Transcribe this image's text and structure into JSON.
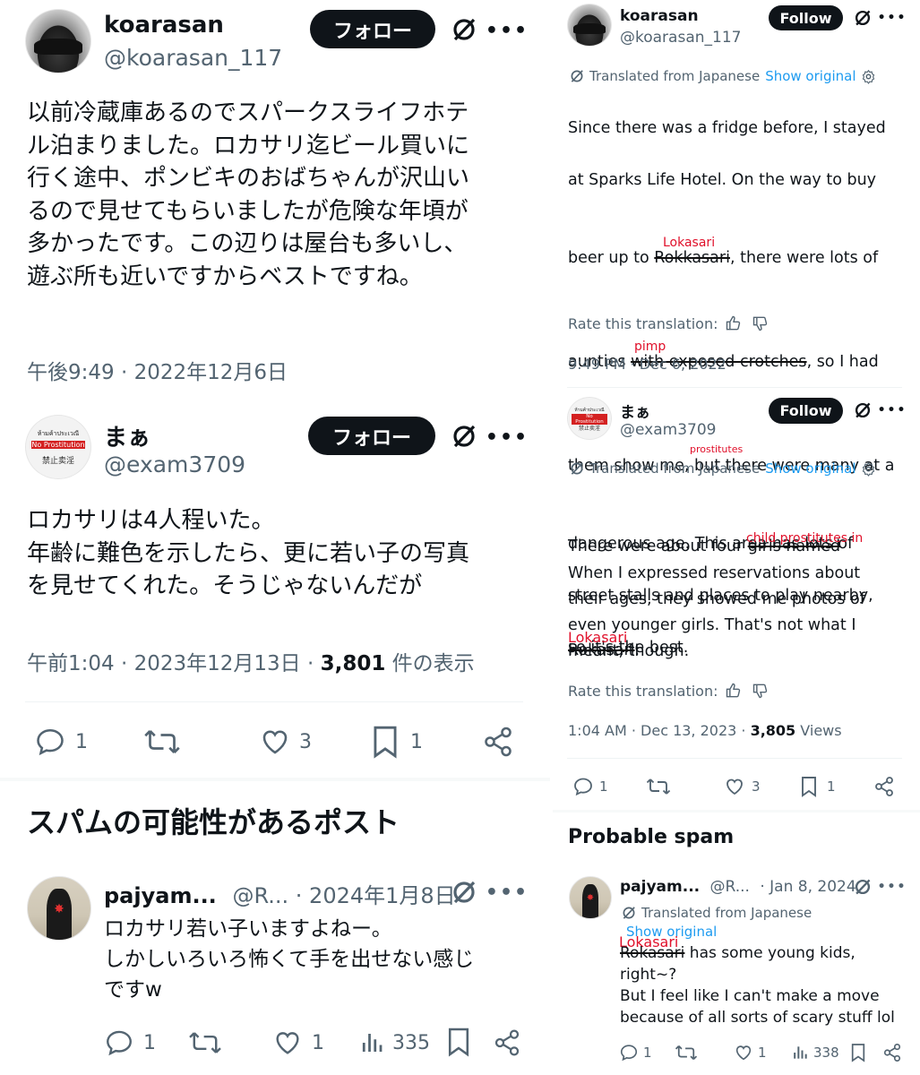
{
  "left": {
    "post1": {
      "name": "koarasan",
      "handle": "@koarasan_117",
      "follow_label": "フォロー",
      "text": "以前冷蔵庫あるのでスパークスライフホテ\nル泊まりました。ロカサリ迄ビール買いに\n行く途中、ポンビキのおばちゃんが沢山い\nるので見せてもらいましたが危険な年頃が\n多かったです。この辺りは屋台も多いし、\n遊ぶ所も近いですからベストですね。",
      "timestamp": "午後9:49 · 2022年12月6日"
    },
    "post2": {
      "name": "まぁ",
      "handle": "@exam3709",
      "follow_label": "フォロー",
      "text": "ロカサリは4人程いた。\n年齢に難色を示したら、更に若い子の写真\nを見せてくれた。そうじゃないんだが",
      "timestamp": "午前1:04 · 2023年12月13日 · ",
      "views_count": "3,801",
      "views_label": " 件の表示",
      "replies": "1",
      "reposts": "",
      "likes": "3",
      "bookmarks": "1"
    },
    "section_title": "スパムの可能性があるポスト",
    "post3": {
      "name": "pajyam...",
      "handle": "@R...",
      "date": " · 2024年1月8日",
      "text": "ロカサリ若い子いますよねー。\nしかしいろいろ怖くて手を出せない感じ\nですw",
      "replies": "1",
      "likes": "1",
      "views": "335"
    }
  },
  "right": {
    "post1": {
      "name": "koarasan",
      "handle": "@koarasan_117",
      "follow_label": "Follow",
      "translated_label": "Translated from Japanese",
      "show_original": "Show original",
      "line1": "Since there was a fridge before, I stayed",
      "line2": "at Sparks Life Hotel. On the way to buy",
      "line3a": "beer up to ",
      "line3_strike": "Rokkasari",
      "line3b": ", there were lots of",
      "line4a": "aunties ",
      "line4_strike": "with exposed crotches",
      "line4b": ", so I had",
      "line5": "them show me, but there were many at a",
      "line6": "dangerous age. This area has lots of",
      "line7": "street stalls and places to play nearby,",
      "line8": "so it's the best.",
      "annot_lokasari": "Lokasari",
      "annot_pimp": "pimp",
      "annot_prostitutes": "prostitutes",
      "rate_label": "Rate this translation:",
      "timestamp": "9:49 PM · Dec 6, 2022"
    },
    "post2": {
      "name": "まぁ",
      "handle": "@exam3709",
      "follow_label": "Follow",
      "translated_label": "Translated from Japanese",
      "show_original": "Show original",
      "line1a": "There were about four ",
      "line1_strike": "girls named",
      "line2_strike": "Rokasari",
      "line2b": ".",
      "annot_child": "child prostitutes in",
      "annot_lokasari": "Lokasari",
      "para2": "When I expressed reservations about\ntheir ages, they showed me photos of\neven younger girls. That's not what I\nmeant, though.",
      "rate_label": "Rate this translation:",
      "timestamp": "1:04 AM · Dec 13, 2023 · ",
      "views_count": "3,805",
      "views_label": " Views",
      "replies": "1",
      "likes": "3",
      "bookmarks": "1"
    },
    "section_title": "Probable spam",
    "post3": {
      "name": "pajyam...",
      "handle": "@R...",
      "date": " · Jan 8, 2024",
      "translated_label": "Translated from Japanese",
      "show_original": "Show original",
      "annot_lokasari": "Lokasari",
      "line1_strike": "Rokasari",
      "line1b": " has some young kids,",
      "line2": "right~?",
      "line3": "But I feel like I can't make a move",
      "line4": "because of all sorts of scary stuff lol",
      "replies": "1",
      "likes": "1",
      "views": "338"
    }
  },
  "icons": [
    "grok-icon",
    "more-icon",
    "reply-icon",
    "repost-icon",
    "like-icon",
    "bookmark-icon",
    "share-icon",
    "views-icon",
    "thumbs-up-icon",
    "thumbs-down-icon",
    "gear-icon",
    "translate-icon"
  ]
}
